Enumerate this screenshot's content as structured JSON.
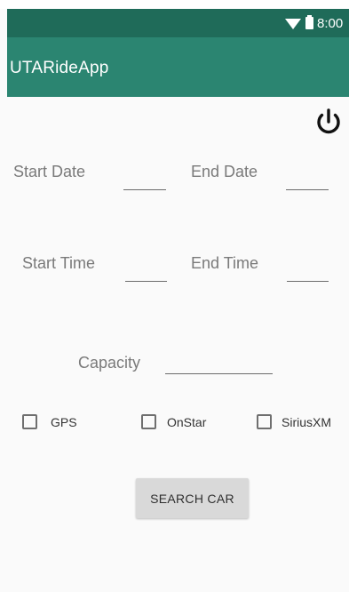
{
  "status_bar": {
    "time": "8:00",
    "icons": [
      "wifi-icon",
      "battery-icon"
    ]
  },
  "app_bar": {
    "title": "UTARideApp"
  },
  "toolbar": {
    "power_icon": "power-icon"
  },
  "form": {
    "start_date_label": "Start Date",
    "end_date_label": "End Date",
    "start_time_label": "Start Time",
    "end_time_label": "End Time",
    "capacity_label": "Capacity",
    "start_date_value": "",
    "end_date_value": "",
    "start_time_value": "",
    "end_time_value": "",
    "capacity_value": ""
  },
  "features": [
    {
      "label": "GPS",
      "checked": false
    },
    {
      "label": "OnStar",
      "checked": false
    },
    {
      "label": "SiriusXM",
      "checked": false
    }
  ],
  "actions": {
    "search_label": "SEARCH CAR"
  },
  "colors": {
    "status_bar": "#1f6b59",
    "app_bar": "#2b8571",
    "button": "#d9d9d9"
  }
}
